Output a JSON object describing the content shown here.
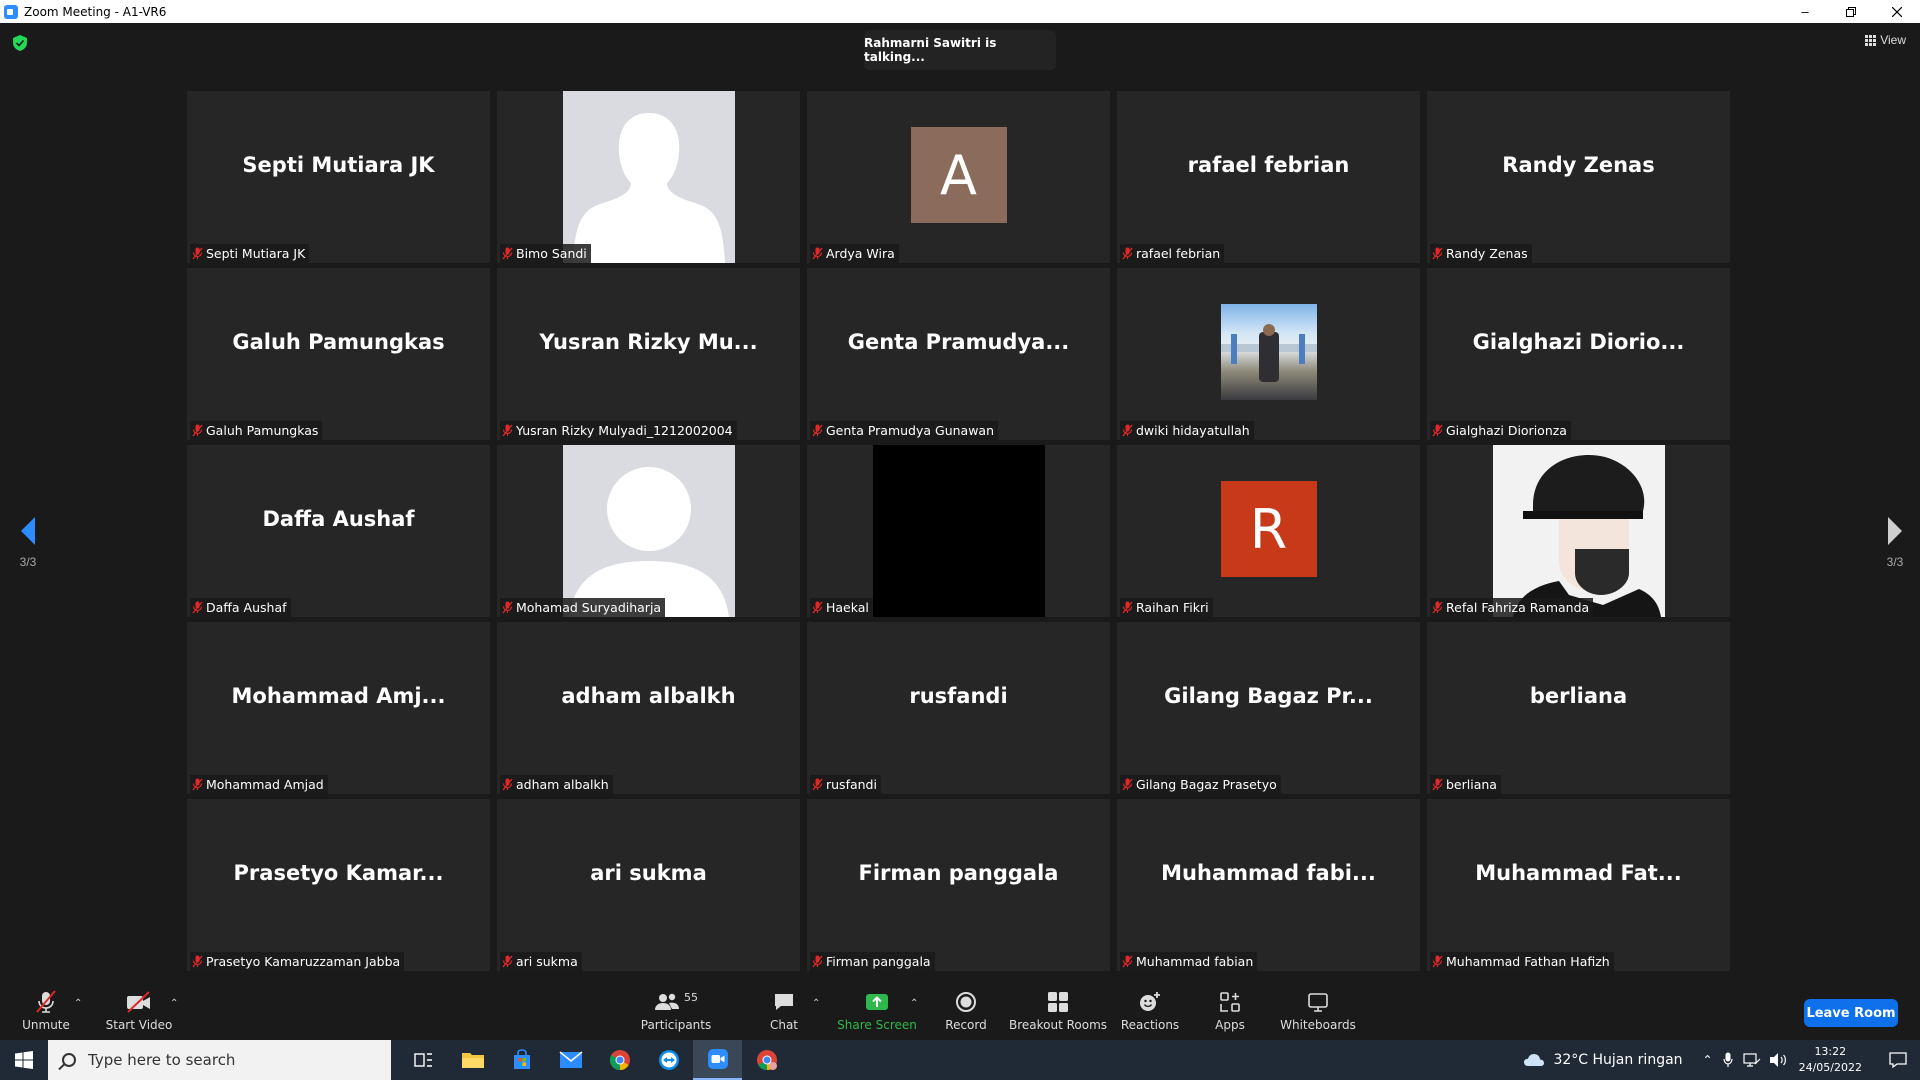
{
  "window": {
    "title": "Zoom Meeting - A1-VR6"
  },
  "meeting": {
    "talking_indicator": "Rahmarni Sawitri is talking...",
    "view_label": "View",
    "page_indicator_left": "3/3",
    "page_indicator_right": "3/3"
  },
  "participants": [
    {
      "display": "Septi Mutiara JK",
      "label": "Septi Mutiara JK",
      "avatar": "none"
    },
    {
      "display": "",
      "label": "Bimo Sandi",
      "avatar": "silhouette"
    },
    {
      "display": "",
      "label": "Ardya Wira",
      "avatar": "letter",
      "letter": "A",
      "color": "#8b6c5c"
    },
    {
      "display": "rafael febrian",
      "label": "rafael febrian",
      "avatar": "none"
    },
    {
      "display": "Randy Zenas",
      "label": "Randy Zenas",
      "avatar": "none"
    },
    {
      "display": "Galuh Pamungkas",
      "label": "Galuh Pamungkas",
      "avatar": "none"
    },
    {
      "display": "Yusran  Rizky  Mu...",
      "label": "Yusran Rizky Mulyadi_1212002004",
      "avatar": "none"
    },
    {
      "display": "Genta  Pramudya...",
      "label": "Genta Pramudya Gunawan",
      "avatar": "none"
    },
    {
      "display": "",
      "label": "dwiki hidayatullah",
      "avatar": "photo"
    },
    {
      "display": "Gialghazi  Diorio...",
      "label": "Gialghazi Diorionza",
      "avatar": "none"
    },
    {
      "display": "Daffa Aushaf",
      "label": "Daffa Aushaf",
      "avatar": "none"
    },
    {
      "display": "",
      "label": "Mohamad Suryadiharja",
      "avatar": "silhouette-round"
    },
    {
      "display": "",
      "label": "Haekal",
      "avatar": "black"
    },
    {
      "display": "",
      "label": "Raihan Fikri",
      "avatar": "letter",
      "letter": "R",
      "color": "#c8391a"
    },
    {
      "display": "",
      "label": "Refal Fahriza Ramanda",
      "avatar": "anime"
    },
    {
      "display": "Mohammad  Amj...",
      "label": "Mohammad Amjad",
      "avatar": "none"
    },
    {
      "display": "adham albalkh",
      "label": "adham albalkh",
      "avatar": "none"
    },
    {
      "display": "rusfandi",
      "label": "rusfandi",
      "avatar": "none"
    },
    {
      "display": "Gilang  Bagaz  Pr...",
      "label": "Gilang Bagaz Prasetyo",
      "avatar": "none"
    },
    {
      "display": "berliana",
      "label": "berliana",
      "avatar": "none"
    },
    {
      "display": "Prasetyo  Kamar...",
      "label": "Prasetyo Kamaruzzaman Jabba",
      "avatar": "none"
    },
    {
      "display": "ari sukma",
      "label": "ari sukma",
      "avatar": "none"
    },
    {
      "display": "Firman panggala",
      "label": "Firman panggala",
      "avatar": "none"
    },
    {
      "display": "Muhammad  fabi...",
      "label": "Muhammad fabian",
      "avatar": "none"
    },
    {
      "display": "Muhammad  Fat...",
      "label": "Muhammad Fathan Hafizh",
      "avatar": "none"
    }
  ],
  "toolbar": {
    "unmute": "Unmute",
    "start_video": "Start Video",
    "participants": "Participants",
    "participants_count": "55",
    "chat": "Chat",
    "share_screen": "Share Screen",
    "record": "Record",
    "breakout_rooms": "Breakout Rooms",
    "reactions": "Reactions",
    "apps": "Apps",
    "whiteboards": "Whiteboards",
    "leave_room": "Leave Room"
  },
  "taskbar": {
    "search_placeholder": "Type here to search",
    "weather": "32°C  Hujan ringan",
    "time": "13:22",
    "date": "24/05/2022"
  },
  "colors": {
    "accent_blue": "#0e71eb",
    "share_green": "#2fb84b",
    "muted_red": "#e02828",
    "tile_bg": "#262626"
  }
}
